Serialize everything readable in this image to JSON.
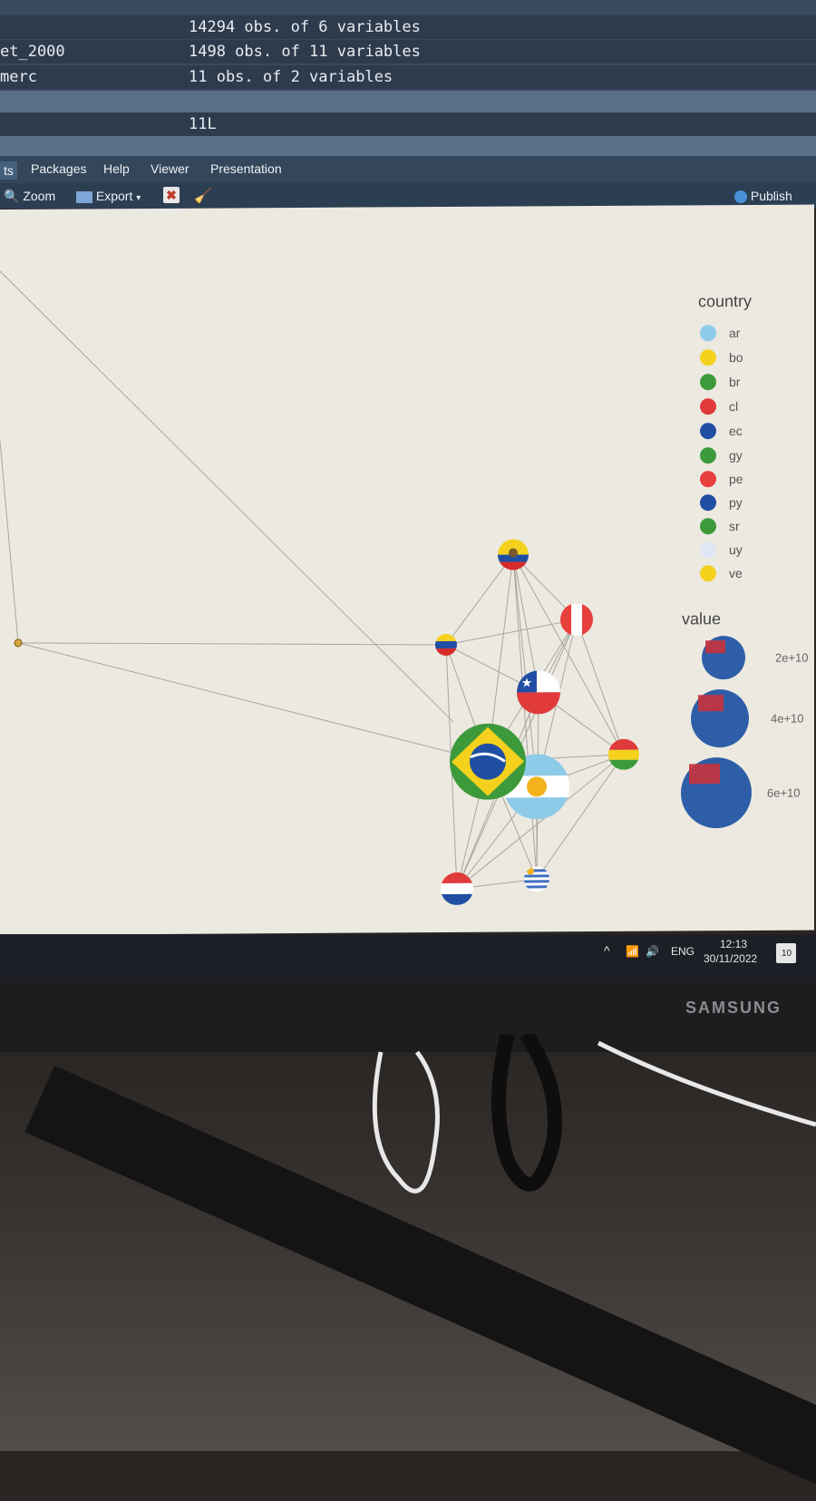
{
  "environment": {
    "rows": [
      {
        "name": "",
        "value": "14294 obs. of 6 variables"
      },
      {
        "name": "et_2000",
        "value": "1498 obs. of 11 variables"
      },
      {
        "name": "merc",
        "value": "11 obs. of 2 variables"
      },
      {
        "name": "",
        "value": "11L"
      }
    ]
  },
  "tabs": [
    "ts",
    "Packages",
    "Help",
    "Viewer",
    "Presentation"
  ],
  "toolbar": {
    "zoom": "Zoom",
    "export": "Export",
    "publish": "Publish"
  },
  "legend": {
    "country_title": "country",
    "countries": [
      "ar",
      "bo",
      "br",
      "cl",
      "ec",
      "gy",
      "pe",
      "py",
      "sr",
      "uy",
      "ve"
    ],
    "value_title": "value",
    "value_labels": [
      "2e+10",
      "4e+10",
      "6e+10"
    ]
  },
  "nodes": [
    {
      "id": "ec",
      "flag": "ecuador-flag-icon"
    },
    {
      "id": "pe",
      "flag": "peru-flag-icon"
    },
    {
      "id": "ve",
      "flag": "venezuela-flag-icon"
    },
    {
      "id": "cl",
      "flag": "chile-flag-icon"
    },
    {
      "id": "br",
      "flag": "brazil-flag-icon"
    },
    {
      "id": "ar",
      "flag": "argentina-flag-icon"
    },
    {
      "id": "bo",
      "flag": "bolivia-flag-icon"
    },
    {
      "id": "py",
      "flag": "paraguay-flag-icon"
    },
    {
      "id": "uy",
      "flag": "uruguay-flag-icon"
    },
    {
      "id": "gy",
      "flag": "guyana-flag-icon"
    }
  ],
  "taskbar": {
    "lang": "ENG",
    "time": "12:13",
    "date": "30/11/2022",
    "notif": "10"
  },
  "monitor_brand": "SAMSUNG"
}
